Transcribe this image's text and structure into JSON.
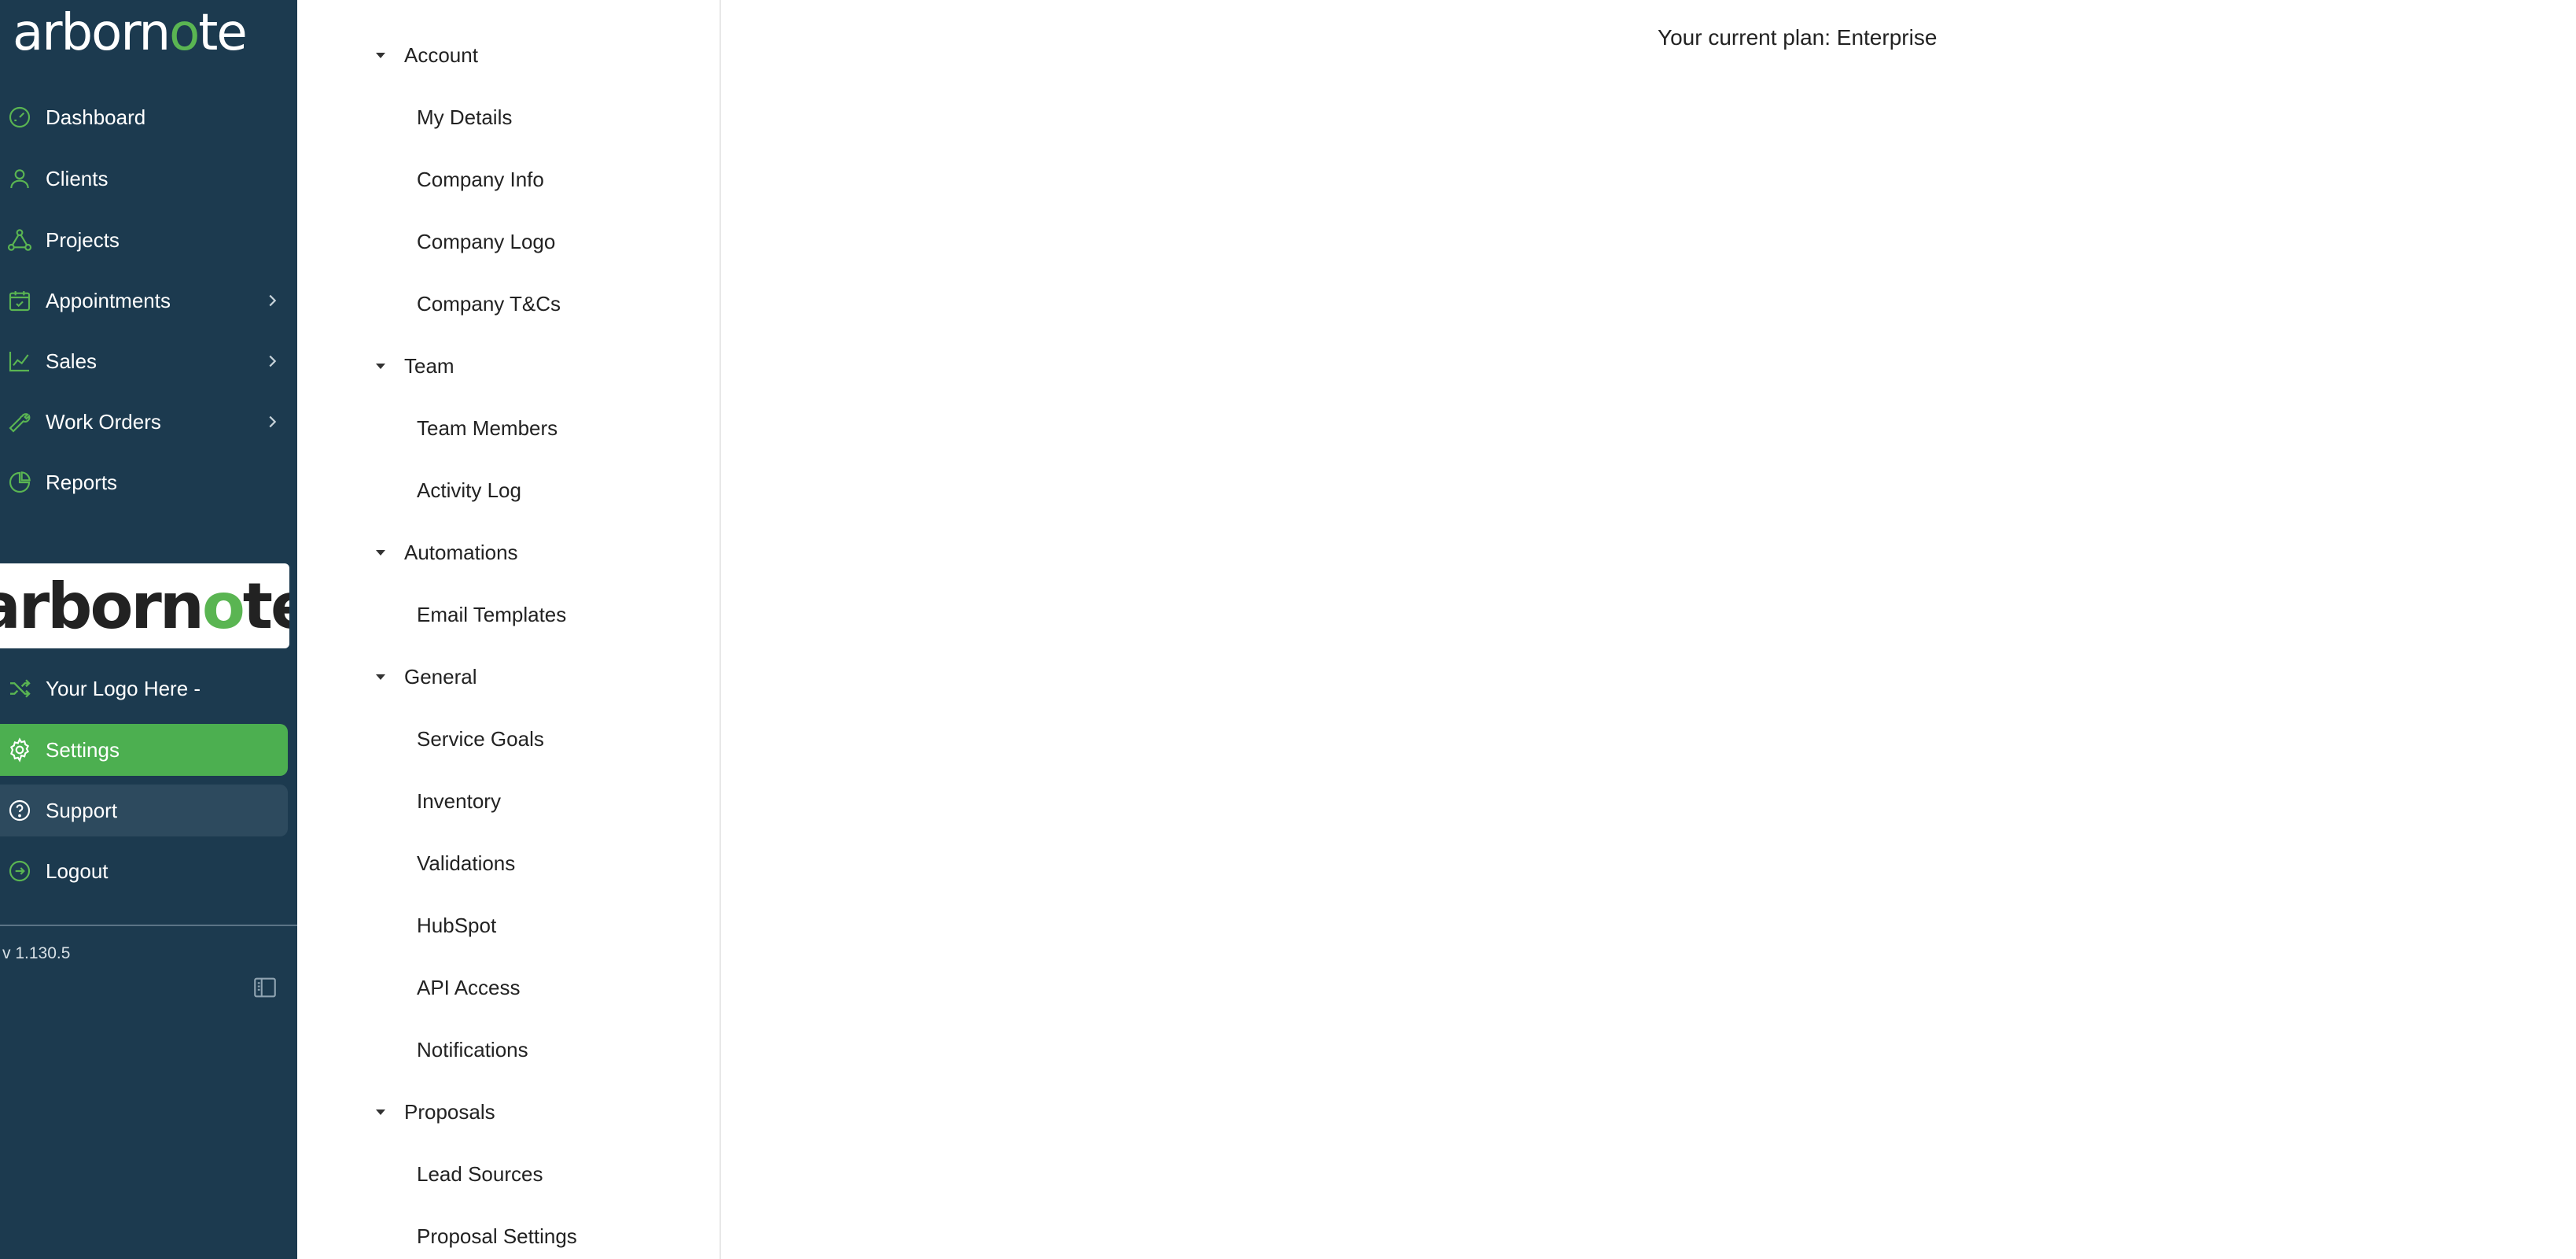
{
  "brand": {
    "name_part1": "arborn",
    "name_o": "o",
    "name_part2": "te"
  },
  "sidebar": {
    "items": [
      {
        "label": "Dashboard",
        "icon": "dashboard-gauge-icon",
        "has_submenu": false
      },
      {
        "label": "Clients",
        "icon": "user-icon",
        "has_submenu": false
      },
      {
        "label": "Projects",
        "icon": "projects-nodes-icon",
        "has_submenu": false
      },
      {
        "label": "Appointments",
        "icon": "calendar-check-icon",
        "has_submenu": true
      },
      {
        "label": "Sales",
        "icon": "line-chart-icon",
        "has_submenu": true
      },
      {
        "label": "Work Orders",
        "icon": "wrench-icon",
        "has_submenu": true
      },
      {
        "label": "Reports",
        "icon": "pie-chart-icon",
        "has_submenu": false
      }
    ],
    "client_logo": {
      "part1": "arborn",
      "o": "o",
      "part2": "te"
    },
    "lower_items": [
      {
        "label": "Your Logo Here -",
        "icon": "shuffle-icon",
        "state": "normal"
      },
      {
        "label": "Settings",
        "icon": "gear-icon",
        "state": "active"
      },
      {
        "label": "Support",
        "icon": "help-circle-icon",
        "state": "hover"
      },
      {
        "label": "Logout",
        "icon": "logout-icon",
        "state": "normal"
      }
    ],
    "version": "v 1.130.5"
  },
  "settings_menu": {
    "groups": [
      {
        "label": "Account",
        "items": [
          "My Details",
          "Company Info",
          "Company Logo",
          "Company T&Cs"
        ]
      },
      {
        "label": "Team",
        "items": [
          "Team Members",
          "Activity Log"
        ]
      },
      {
        "label": "Automations",
        "items": [
          "Email Templates"
        ]
      },
      {
        "label": "General",
        "items": [
          "Service Goals",
          "Inventory",
          "Validations",
          "HubSpot",
          "API Access",
          "Notifications"
        ]
      },
      {
        "label": "Proposals",
        "items": [
          "Lead Sources",
          "Proposal Settings"
        ]
      }
    ]
  },
  "main": {
    "plan_text": "Your current plan: Enterprise"
  },
  "colors": {
    "sidebar_bg": "#1c3a4f",
    "accent_green": "#4caf50",
    "hover_bg": "#2d4a5e",
    "icon_green": "#5ab552"
  }
}
